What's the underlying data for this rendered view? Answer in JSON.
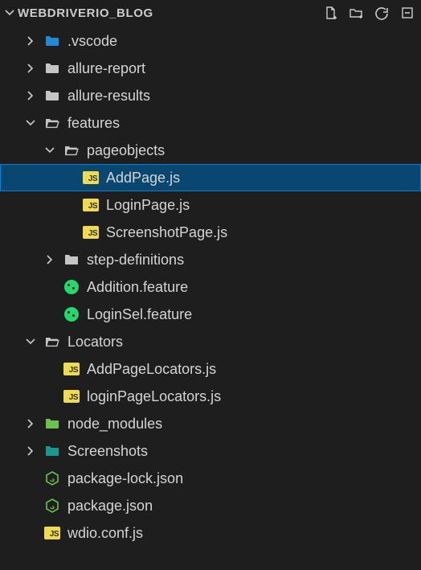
{
  "title": "WEBDRIVERIO_BLOG",
  "tree": {
    "vscode": {
      "label": ".vscode"
    },
    "allure_report": {
      "label": "allure-report"
    },
    "allure_results": {
      "label": "allure-results"
    },
    "features": {
      "label": "features"
    },
    "pageobjects": {
      "label": "pageobjects"
    },
    "addpage": {
      "label": "AddPage.js"
    },
    "loginpage": {
      "label": "LoginPage.js"
    },
    "screenshotpage": {
      "label": "ScreenshotPage.js"
    },
    "step_definitions": {
      "label": "step-definitions"
    },
    "addition_feature": {
      "label": "Addition.feature"
    },
    "loginsel_feature": {
      "label": "LoginSel.feature"
    },
    "locators": {
      "label": "Locators"
    },
    "addpagelocators": {
      "label": "AddPageLocators.js"
    },
    "loginpagelocators": {
      "label": "loginPageLocators.js"
    },
    "node_modules": {
      "label": "node_modules"
    },
    "screenshots": {
      "label": "Screenshots"
    },
    "package_lock": {
      "label": "package-lock.json"
    },
    "package_json": {
      "label": "package.json"
    },
    "wdio_conf": {
      "label": "wdio.conf.js"
    }
  }
}
